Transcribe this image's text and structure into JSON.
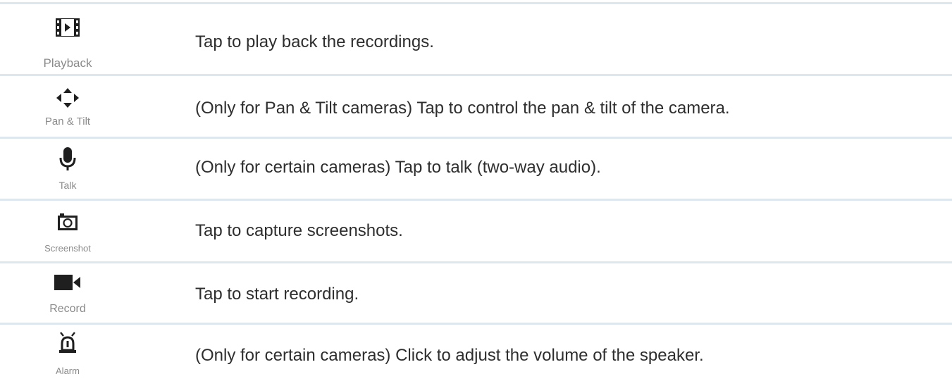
{
  "rows": [
    {
      "icon": "playback-icon",
      "label": "Playback",
      "text": "Tap to play back the recordings."
    },
    {
      "icon": "pan-tilt-icon",
      "label": "Pan & Tilt",
      "text": "(Only for Pan & Tilt cameras) Tap to control the pan & tilt of the camera."
    },
    {
      "icon": "microphone-icon",
      "label": "Talk",
      "text": "(Only for certain cameras) Tap to talk (two-way audio)."
    },
    {
      "icon": "camera-icon",
      "label": "Screenshot",
      "text": "Tap to capture screenshots."
    },
    {
      "icon": "video-camera-icon",
      "label": "Record",
      "text": "Tap to start recording."
    },
    {
      "icon": "alarm-siren-icon",
      "label": "Alarm",
      "text": "(Only for certain cameras) Click to adjust the volume of the speaker."
    }
  ],
  "colors": {
    "separator": "#dce8ee",
    "icon": "#1f1f1f",
    "label": "#8a8a8a",
    "text": "#2e2e2e"
  }
}
